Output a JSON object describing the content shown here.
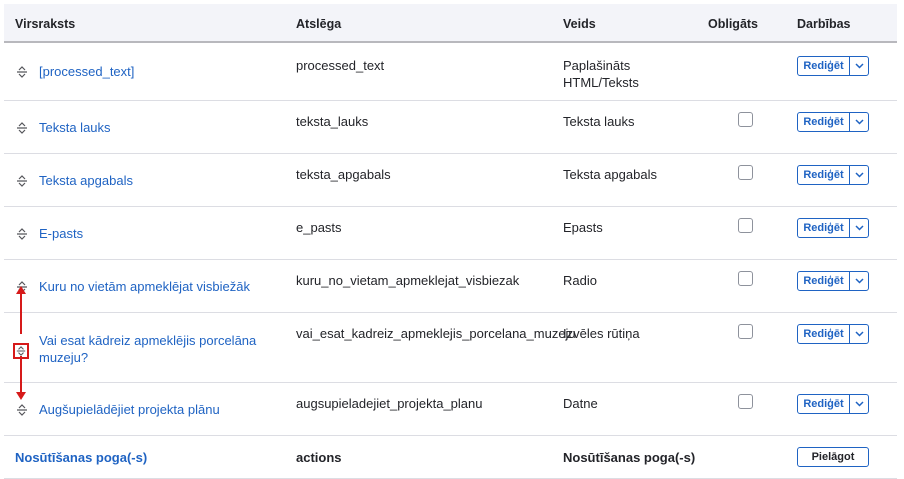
{
  "columns": {
    "title": "Virsraksts",
    "key": "Atslēga",
    "type": "Veids",
    "required": "Obligāts",
    "operations": "Darbības"
  },
  "rows": [
    {
      "title": "[processed_text]",
      "key": "processed_text",
      "type_line1": "Paplašināts",
      "type_line2": "HTML/Teksts",
      "has_checkbox": false
    },
    {
      "title": "Teksta lauks",
      "key": "teksta_lauks",
      "type": "Teksta lauks",
      "has_checkbox": true
    },
    {
      "title": "Teksta apgabals",
      "key": "teksta_apgabals",
      "type": "Teksta apgabals",
      "has_checkbox": true
    },
    {
      "title": "E-pasts",
      "key": "e_pasts",
      "type": "Epasts",
      "has_checkbox": true
    },
    {
      "title": "Kuru no vietām apmeklējat visbiežāk",
      "key": "kuru_no_vietam_apmeklejat_visbiezak",
      "type": "Radio",
      "has_checkbox": true
    },
    {
      "title_line1": "Vai esat kādreiz apmeklējis porcelāna",
      "title_line2": "muzeju?",
      "key": "vai_esat_kadreiz_apmeklejis_porcelana_muzeju",
      "type": "Izvēles rūtiņa",
      "has_checkbox": true
    },
    {
      "title": "Augšupielādējiet projekta plānu",
      "key": "augsupieladejiet_projekta_planu",
      "type": "Datne",
      "has_checkbox": true
    }
  ],
  "edit_label": "Rediģēt",
  "footer": {
    "title": "Nosūtīšanas poga(-s)",
    "key": "actions",
    "type": "Nosūtīšanas poga(-s)",
    "customize_label": "Pielāgot"
  },
  "annotation_color": "#d61a1a",
  "link_color": "#1f63c3",
  "icons": {
    "drag_handle": "drag-handle-icon",
    "dropdown": "chevron-down-icon"
  }
}
